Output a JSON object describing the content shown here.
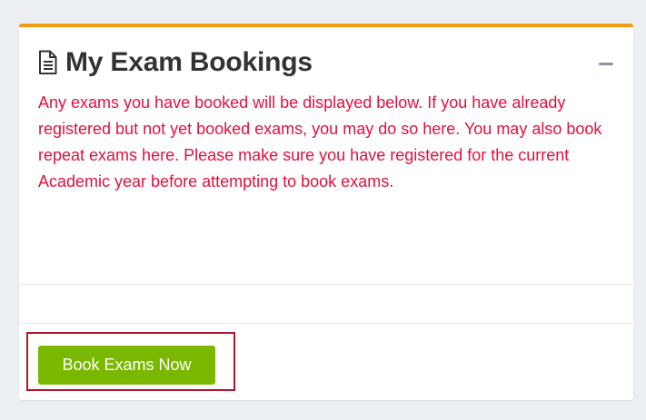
{
  "panel": {
    "title": "My Exam Bookings",
    "message": "Any exams you have booked will be displayed below.  If you have already registered but not yet booked exams, you may do so here. You may also book repeat exams here.  Please make sure you have registered for the current Academic year before attempting to book exams.",
    "collapse_icon": "minus-icon",
    "title_icon": "document-icon"
  },
  "actions": {
    "book_exams_label": "Book Exams Now"
  },
  "colors": {
    "accent": "#f39c12",
    "message": "#e4103f",
    "button": "#7ab800",
    "highlight": "#b0172d"
  }
}
